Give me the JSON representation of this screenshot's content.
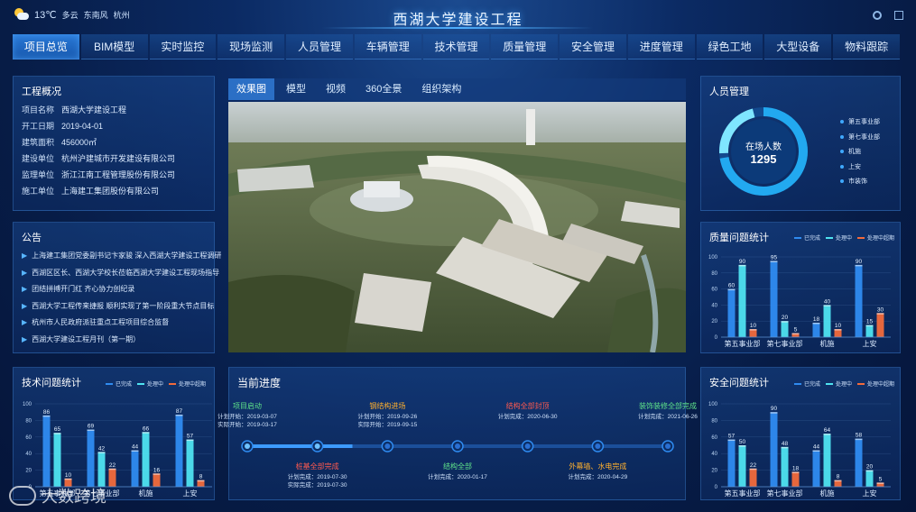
{
  "weather": {
    "temp": "13℃",
    "cond": "多云",
    "wind": "东南风",
    "city": "杭州"
  },
  "title": "西湖大学建设工程",
  "nav": [
    "项目总览",
    "BIM模型",
    "实时监控",
    "现场监测",
    "人员管理",
    "车辆管理",
    "技术管理",
    "质量管理",
    "安全管理",
    "进度管理",
    "绿色工地",
    "大型设备",
    "物料跟踪"
  ],
  "overview": {
    "title": "工程概况",
    "rows": [
      {
        "k": "项目名称",
        "v": "西湖大学建设工程"
      },
      {
        "k": "开工日期",
        "v": "2019-04-01"
      },
      {
        "k": "建筑面积",
        "v": "456000㎡"
      },
      {
        "k": "建设单位",
        "v": "杭州沪建城市开发建设有限公司"
      },
      {
        "k": "监理单位",
        "v": "浙江江南工程管理股份有限公司"
      },
      {
        "k": "施工单位",
        "v": "上海建工集团股份有限公司"
      }
    ]
  },
  "notice": {
    "title": "公告",
    "items": [
      "上海建工集团党委副书记卞家骏 深入西湖大学建设工程调研",
      "西湖区区长、西湖大学校长莅临西湖大学建设工程现场指导",
      "团结拼搏开门红 齐心协力创纪录",
      "西湖大学工程传来捷报 顺利实现了第一阶段重大节点目标",
      "杭州市人民政府派驻重点工程项目综合监督",
      "西湖大学建设工程月刊（第一期）"
    ]
  },
  "center_tabs": [
    "效果图",
    "模型",
    "视频",
    "360全景",
    "组织架构"
  ],
  "personnel": {
    "title": "人员管理",
    "center_label": "在场人数",
    "count": "1295",
    "legend": [
      {
        "name": "第五事业部",
        "color": "#3fa9ff"
      },
      {
        "name": "第七事业部",
        "color": "#3fa9ff"
      },
      {
        "name": "机施",
        "color": "#3fa9ff"
      },
      {
        "name": "上安",
        "color": "#3fa9ff"
      },
      {
        "name": "市装饰",
        "color": "#3fa9ff"
      }
    ]
  },
  "legend_labels": {
    "done": "已完成",
    "doing": "处理中",
    "overdue": "处理中超期"
  },
  "colors": {
    "done": "#2f8bf0",
    "doing": "#4fe3f0",
    "overdue": "#f26a3c"
  },
  "chart_data": [
    {
      "id": "quality",
      "title": "质量问题统计",
      "type": "bar",
      "categories": [
        "第五事业部",
        "第七事业部",
        "机施",
        "上安"
      ],
      "series": [
        {
          "name": "已完成",
          "values": [
            60,
            95,
            18,
            90
          ]
        },
        {
          "name": "处理中",
          "values": [
            90,
            20,
            40,
            15
          ]
        },
        {
          "name": "处理中超期",
          "values": [
            10,
            5,
            10,
            30
          ]
        }
      ],
      "ylim": [
        0,
        100
      ],
      "yticks": [
        0,
        20,
        40,
        60,
        80,
        100
      ]
    },
    {
      "id": "tech",
      "title": "技术问题统计",
      "type": "bar",
      "categories": [
        "第五事业部",
        "第七事业部",
        "机施",
        "上安"
      ],
      "series": [
        {
          "name": "已完成",
          "values": [
            86,
            69,
            44,
            87
          ]
        },
        {
          "name": "处理中",
          "values": [
            65,
            42,
            66,
            57
          ]
        },
        {
          "name": "处理中超期",
          "values": [
            10,
            22,
            16,
            8
          ]
        }
      ],
      "ylim": [
        0,
        100
      ],
      "yticks": [
        0,
        20,
        40,
        60,
        80,
        100
      ]
    },
    {
      "id": "safety",
      "title": "安全问题统计",
      "type": "bar",
      "categories": [
        "第五事业部",
        "第七事业部",
        "机施",
        "上安"
      ],
      "series": [
        {
          "name": "已完成",
          "values": [
            57,
            90,
            44,
            58
          ]
        },
        {
          "name": "处理中",
          "values": [
            50,
            48,
            64,
            20
          ]
        },
        {
          "name": "处理中超期",
          "values": [
            22,
            18,
            8,
            5
          ]
        }
      ],
      "ylim": [
        0,
        100
      ],
      "yticks": [
        0,
        20,
        40,
        60,
        80,
        100
      ]
    }
  ],
  "progress": {
    "title": "当前进度",
    "milestones": [
      {
        "name": "项目启动",
        "color": "#5fe38a",
        "lines": [
          "计划开始：2019-03-07",
          "实际开始：2019-03-17"
        ],
        "side": "top"
      },
      {
        "name": "桩基全部完成",
        "color": "#ff5a4f",
        "lines": [
          "计划完成：2019-07-30",
          "实际完成：2019-07-30"
        ],
        "side": "bottom"
      },
      {
        "name": "钢结构进场",
        "color": "#ffb02e",
        "lines": [
          "计划开始：2019-09-26",
          "实际开始：2019-09-15"
        ],
        "side": "top"
      },
      {
        "name": "结构全部",
        "color": "#5fe38a",
        "lines": [
          "计划完成：2020-01-17"
        ],
        "side": "bottom"
      },
      {
        "name": "结构全部封顶",
        "color": "#ff5a4f",
        "lines": [
          "计划完成：2020-06-30"
        ],
        "side": "top"
      },
      {
        "name": "外幕墙、水电完成",
        "color": "#ffb02e",
        "lines": [
          "计划完成：2020-04-29"
        ],
        "side": "bottom"
      },
      {
        "name": "装饰装修全部完成",
        "color": "#5fe38a",
        "lines": [
          "计划完成：2021-06-26"
        ],
        "side": "top"
      }
    ],
    "done_count": 2
  },
  "watermark": "大数跨境"
}
